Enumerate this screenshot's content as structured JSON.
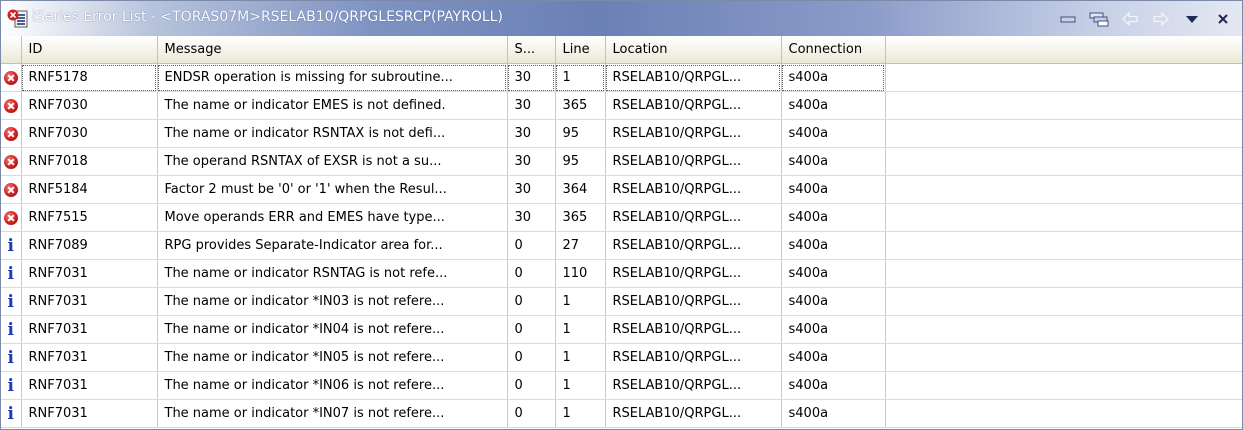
{
  "window": {
    "title": "iSeries Error List - <TORAS07M>RSELAB10/QRPGLESRCP(PAYROLL)"
  },
  "toolbar": [
    "minimize-icon",
    "layout-icon",
    "back-arrow-icon",
    "forward-arrow-icon",
    "view-menu-icon",
    "close-icon"
  ],
  "table": {
    "columns": [
      "",
      "ID",
      "Message",
      "S...",
      "Line",
      "Location",
      "Connection",
      ""
    ],
    "rows": [
      {
        "type": "error",
        "id": "RNF5178",
        "message": "ENDSR operation is missing for subroutine...",
        "severity": "30",
        "line": "1",
        "location": "RSELAB10/QRPGL...",
        "connection": "s400a"
      },
      {
        "type": "error",
        "id": "RNF7030",
        "message": "The name or indicator EMES is not defined.",
        "severity": "30",
        "line": "365",
        "location": "RSELAB10/QRPGL...",
        "connection": "s400a"
      },
      {
        "type": "error",
        "id": "RNF7030",
        "message": "The name or indicator RSNTAX is not defi...",
        "severity": "30",
        "line": "95",
        "location": "RSELAB10/QRPGL...",
        "connection": "s400a"
      },
      {
        "type": "error",
        "id": "RNF7018",
        "message": "The operand RSNTAX of EXSR is not a su...",
        "severity": "30",
        "line": "95",
        "location": "RSELAB10/QRPGL...",
        "connection": "s400a"
      },
      {
        "type": "error",
        "id": "RNF5184",
        "message": "Factor 2 must be '0' or '1' when the Resul...",
        "severity": "30",
        "line": "364",
        "location": "RSELAB10/QRPGL...",
        "connection": "s400a"
      },
      {
        "type": "error",
        "id": "RNF7515",
        "message": "Move operands ERR and EMES have type...",
        "severity": "30",
        "line": "365",
        "location": "RSELAB10/QRPGL...",
        "connection": "s400a"
      },
      {
        "type": "info",
        "id": "RNF7089",
        "message": "RPG provides Separate-Indicator area for...",
        "severity": "0",
        "line": "27",
        "location": "RSELAB10/QRPGL...",
        "connection": "s400a"
      },
      {
        "type": "info",
        "id": "RNF7031",
        "message": "The name or indicator RSNTAG is not refe...",
        "severity": "0",
        "line": "110",
        "location": "RSELAB10/QRPGL...",
        "connection": "s400a"
      },
      {
        "type": "info",
        "id": "RNF7031",
        "message": "The name or indicator *IN03 is not refere...",
        "severity": "0",
        "line": "1",
        "location": "RSELAB10/QRPGL...",
        "connection": "s400a"
      },
      {
        "type": "info",
        "id": "RNF7031",
        "message": "The name or indicator *IN04 is not refere...",
        "severity": "0",
        "line": "1",
        "location": "RSELAB10/QRPGL...",
        "connection": "s400a"
      },
      {
        "type": "info",
        "id": "RNF7031",
        "message": "The name or indicator *IN05 is not refere...",
        "severity": "0",
        "line": "1",
        "location": "RSELAB10/QRPGL...",
        "connection": "s400a"
      },
      {
        "type": "info",
        "id": "RNF7031",
        "message": "The name or indicator *IN06 is not refere...",
        "severity": "0",
        "line": "1",
        "location": "RSELAB10/QRPGL...",
        "connection": "s400a"
      },
      {
        "type": "info",
        "id": "RNF7031",
        "message": "The name or indicator *IN07 is not refere...",
        "severity": "0",
        "line": "1",
        "location": "RSELAB10/QRPGL...",
        "connection": "s400a"
      }
    ]
  }
}
